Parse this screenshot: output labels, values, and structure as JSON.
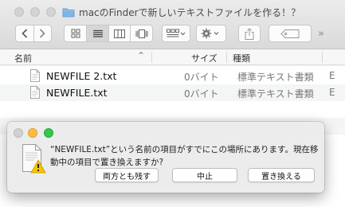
{
  "window": {
    "title": "macのFinderで新しいテキストファイルを作る！？",
    "traffic_light_color": "#d3d3d3"
  },
  "toolbar": {
    "back_icon": "chevron-left-icon",
    "forward_icon": "chevron-right-icon",
    "view_modes": [
      "icon-view-icon",
      "list-view-icon",
      "column-view-icon",
      "cover-flow-icon"
    ],
    "selected_view": "list-view-icon",
    "arrange_icon": "arrange-icon",
    "action_icon": "gear-icon",
    "share_icon": "share-icon",
    "tags_icon": "tag-icon",
    "overflow": "»"
  },
  "list": {
    "columns": {
      "name": "名前",
      "size": "サイズ",
      "kind": "種類"
    },
    "sort_indicator": "⌃",
    "files": [
      {
        "name": "NEWFILE 2.txt",
        "size": "0バイト",
        "kind": "標準テキスト書類",
        "extra": "E"
      },
      {
        "name": "NEWFILE.txt",
        "size": "0バイト",
        "kind": "標準テキスト書類",
        "extra": "E"
      }
    ]
  },
  "alert": {
    "message": "“NEWFILE.txt”という名前の項目がすでにこの場所にあります。現在移動中の項目で置き換えますか?",
    "buttons": {
      "keep_both": "両方とも残す",
      "stop": "中止",
      "replace": "置き換える"
    },
    "colors": {
      "close": "#fc605c",
      "minimize": "#fdbc40",
      "zoom": "#34c84a"
    }
  }
}
